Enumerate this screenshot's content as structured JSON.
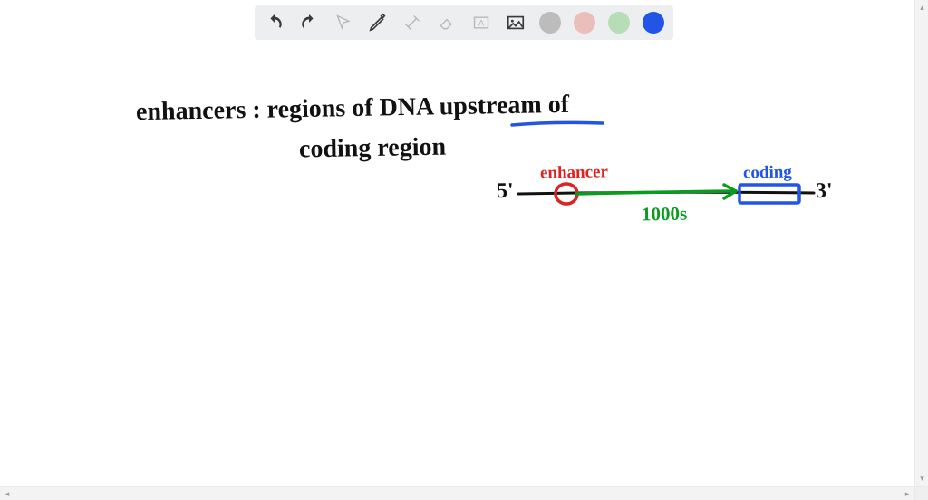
{
  "toolbar": {
    "undo": "undo",
    "redo": "redo",
    "pointer": "pointer",
    "pen": "pen",
    "tools": "tools",
    "eraser": "eraser",
    "textbox": "text-box",
    "image": "insert-image",
    "colors": {
      "gray": "#bcbcbc",
      "pink": "#e9bebb",
      "green": "#b7dcb8",
      "blue": "#2254e6"
    }
  },
  "annotations": {
    "line1": "enhancers : regions of DNA upstream of",
    "line2": "coding region",
    "fiveprime": "5'",
    "threeprime": "3'",
    "enhancer_label": "enhancer",
    "coding_label": "coding",
    "distance_label": "1000s"
  },
  "diagram": {
    "underline_word": "upstream",
    "enhancer_color": "#d22",
    "coding_color": "#2254e6",
    "arrow_color": "#0a9b1f",
    "distance_color": "#0a9b1f"
  }
}
